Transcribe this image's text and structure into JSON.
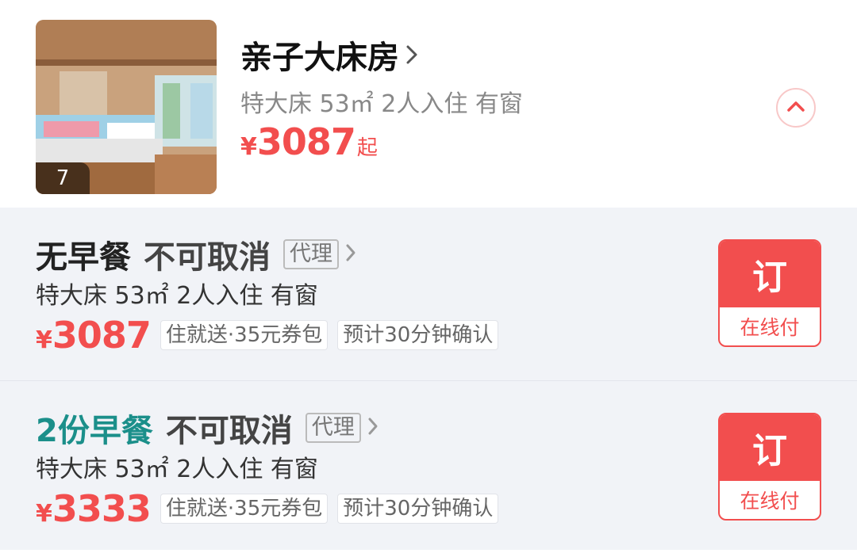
{
  "room": {
    "title": "亲子大床房",
    "spec": "特大床 53㎡ 2人入住 有窗",
    "price_symbol": "¥",
    "price": "3087",
    "price_suffix": "起",
    "photo_count": "7"
  },
  "rates": [
    {
      "meal": "无早餐",
      "policy": "不可取消",
      "agent_tag": "代理",
      "spec": "特大床 53㎡ 2人入住 有窗",
      "price_symbol": "¥",
      "price": "3087",
      "tags": [
        "住就送·35元券包",
        "预计30分钟确认"
      ],
      "book_label": "订",
      "pay_label": "在线付"
    },
    {
      "meal": "2份早餐",
      "policy": "不可取消",
      "agent_tag": "代理",
      "spec": "特大床 53㎡ 2人入住 有窗",
      "price_symbol": "¥",
      "price": "3333",
      "tags": [
        "住就送·35元券包",
        "预计30分钟确认"
      ],
      "book_label": "订",
      "pay_label": "在线付"
    }
  ],
  "colors": {
    "accent": "#f24e4e",
    "breakfast": "#1b8f8a",
    "list_bg": "#f1f3f7"
  },
  "icons": [
    "chevron-right-icon",
    "chevron-up-icon"
  ]
}
